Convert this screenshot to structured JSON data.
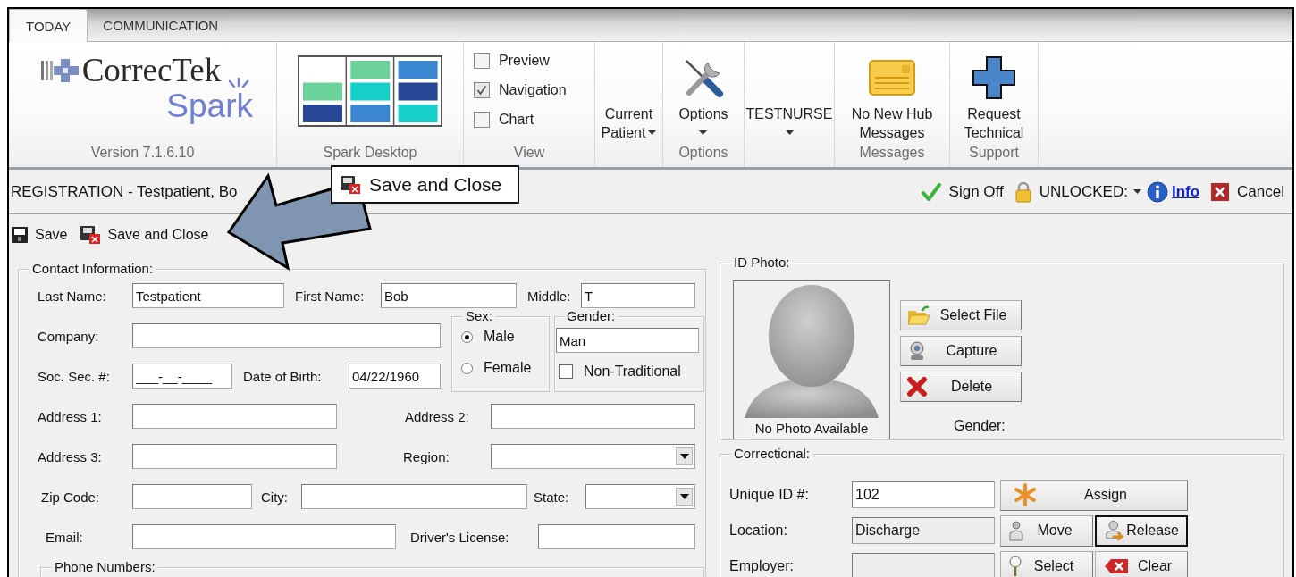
{
  "tabs": [
    {
      "label": "TODAY",
      "selected": true
    },
    {
      "label": "COMMUNICATION",
      "selected": false
    }
  ],
  "ribbon": {
    "groups": [
      {
        "kind": "logo",
        "brand": "CorrecTek",
        "product": "Spark",
        "label": "Version 7.1.6.10"
      },
      {
        "kind": "desktop",
        "label": "Spark Desktop"
      },
      {
        "kind": "checks",
        "label": "View",
        "items": [
          {
            "label": "Preview",
            "checked": false
          },
          {
            "label": "Navigation",
            "checked": true
          },
          {
            "label": "Chart",
            "checked": false
          }
        ]
      },
      {
        "kind": "button",
        "lines": [
          "Current",
          "Patient"
        ],
        "dropdown": true
      },
      {
        "kind": "button",
        "lines": [
          "Options"
        ],
        "dropdown": true,
        "label": "Options"
      },
      {
        "kind": "button",
        "lines": [
          "TESTNURSE"
        ],
        "dropdown": true
      },
      {
        "kind": "button",
        "lines": [
          "No New Hub",
          "Messages"
        ],
        "dropdown": false,
        "label": "Messages"
      },
      {
        "kind": "button",
        "lines": [
          "Request",
          "Technical"
        ],
        "dropdown": false,
        "label": "Support"
      }
    ]
  },
  "title_bar": {
    "title": "REGISTRATION - Testpatient, Bo",
    "actions": [
      {
        "kind": "button",
        "label": "Sign Off"
      },
      {
        "kind": "dropdown",
        "label": "UNLOCKED:"
      },
      {
        "kind": "link",
        "label": "Info"
      },
      {
        "kind": "button",
        "label": "Cancel"
      }
    ]
  },
  "toolbar": [
    {
      "label": "Save"
    },
    {
      "label": "Save and Close"
    }
  ],
  "tooltip": {
    "text": "Save and Close"
  },
  "contact": {
    "legend": "Contact Information:",
    "rows": [
      [
        {
          "label": "Last Name:",
          "kind": "text",
          "value": "Testpatient"
        },
        {
          "label": "First Name:",
          "kind": "text",
          "value": "Bob"
        },
        {
          "label": "Middle:",
          "kind": "text",
          "value": "T"
        }
      ],
      [
        {
          "label": "Company:",
          "kind": "text"
        }
      ],
      [
        {
          "label": "Soc. Sec. #:",
          "kind": "text",
          "value": "___-__-____"
        },
        {
          "label": "Date of Birth:",
          "kind": "text",
          "value": "04/22/1960"
        }
      ],
      [
        {
          "label": "Address 1:",
          "kind": "text"
        },
        {
          "label": "Address 2:",
          "kind": "text"
        }
      ],
      [
        {
          "label": "Address 3:",
          "kind": "text"
        },
        {
          "label": "Region:",
          "kind": "select"
        }
      ],
      [
        {
          "label": "Zip Code:",
          "kind": "text"
        },
        {
          "label": "City:",
          "kind": "text"
        },
        {
          "label": "State:",
          "kind": "select"
        }
      ],
      [
        {
          "label": "Email:",
          "kind": "text"
        },
        {
          "label": "Driver's License:",
          "kind": "text"
        }
      ]
    ],
    "sex": {
      "legend": "Sex:",
      "options": [
        {
          "label": "Male",
          "selected": true
        },
        {
          "label": "Female",
          "selected": false
        }
      ]
    },
    "gender": {
      "legend": "Gender:",
      "value": "Man",
      "non_traditional": {
        "label": "Non-Traditional",
        "checked": false
      }
    },
    "phone": {
      "legend": "Phone Numbers:"
    }
  },
  "id_photo": {
    "legend": "ID Photo:",
    "caption": "No Photo Available",
    "buttons": [
      {
        "label": "Select File"
      },
      {
        "label": "Capture"
      },
      {
        "label": "Delete"
      }
    ],
    "gender_label": "Gender:"
  },
  "correctional": {
    "legend": "Correctional:",
    "rows": [
      {
        "label": "Unique ID #:",
        "value": "102",
        "readonly": false,
        "buttons": [
          {
            "label": "Assign",
            "focused": false
          }
        ]
      },
      {
        "label": "Location:",
        "value": "Discharge",
        "readonly": true,
        "buttons": [
          {
            "label": "Move",
            "focused": false
          },
          {
            "label": "Release",
            "focused": true
          }
        ]
      },
      {
        "label": "Employer:",
        "readonly": true,
        "buttons": [
          {
            "label": "Select",
            "focused": false
          },
          {
            "label": "Clear",
            "focused": false
          }
        ]
      }
    ]
  }
}
